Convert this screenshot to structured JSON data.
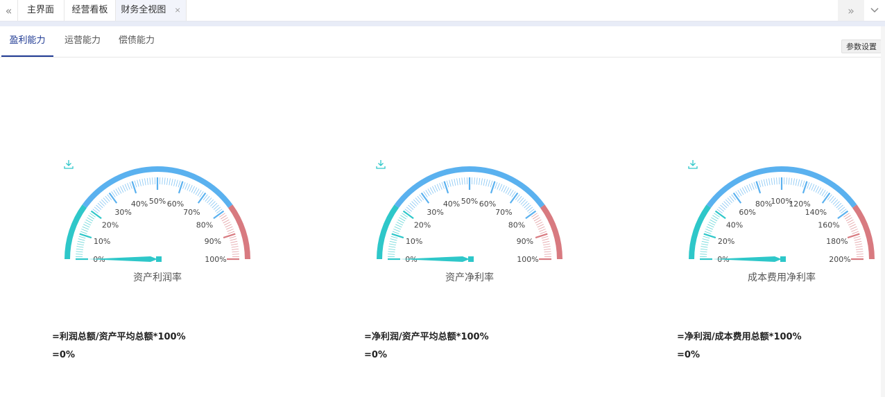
{
  "tabs": {
    "items": [
      {
        "label": "主界面"
      },
      {
        "label": "经营看板"
      },
      {
        "label": "财务全视图"
      }
    ],
    "close_glyph": "×"
  },
  "subtabs": [
    {
      "label": "盈利能力"
    },
    {
      "label": "运营能力"
    },
    {
      "label": "偿债能力"
    }
  ],
  "param_button": "参数设置",
  "colors": {
    "green": "#2ec7c9",
    "blue": "#5ab1ef",
    "red": "#d87a80"
  },
  "gauges": [
    {
      "title": "资产利润率",
      "ticks": [
        "0%",
        "10%",
        "20%",
        "30%",
        "40%",
        "50%",
        "60%",
        "70%",
        "80%",
        "90%",
        "100%"
      ],
      "value": 0,
      "max": 100,
      "formula": "=利润总额/资产平均总额*100%",
      "result": "=0%"
    },
    {
      "title": "资产净利率",
      "ticks": [
        "0%",
        "10%",
        "20%",
        "30%",
        "40%",
        "50%",
        "60%",
        "70%",
        "80%",
        "90%",
        "100%"
      ],
      "value": 0,
      "max": 100,
      "formula": "=净利润/资产平均总额*100%",
      "result": "=0%"
    },
    {
      "title": "成本费用净利率",
      "ticks": [
        "0%",
        "20%",
        "40%",
        "60%",
        "80%",
        "100%",
        "120%",
        "140%",
        "160%",
        "180%",
        "200%"
      ],
      "value": 0,
      "max": 200,
      "formula": "=净利润/成本费用总额*100%",
      "result": "=0%"
    }
  ]
}
